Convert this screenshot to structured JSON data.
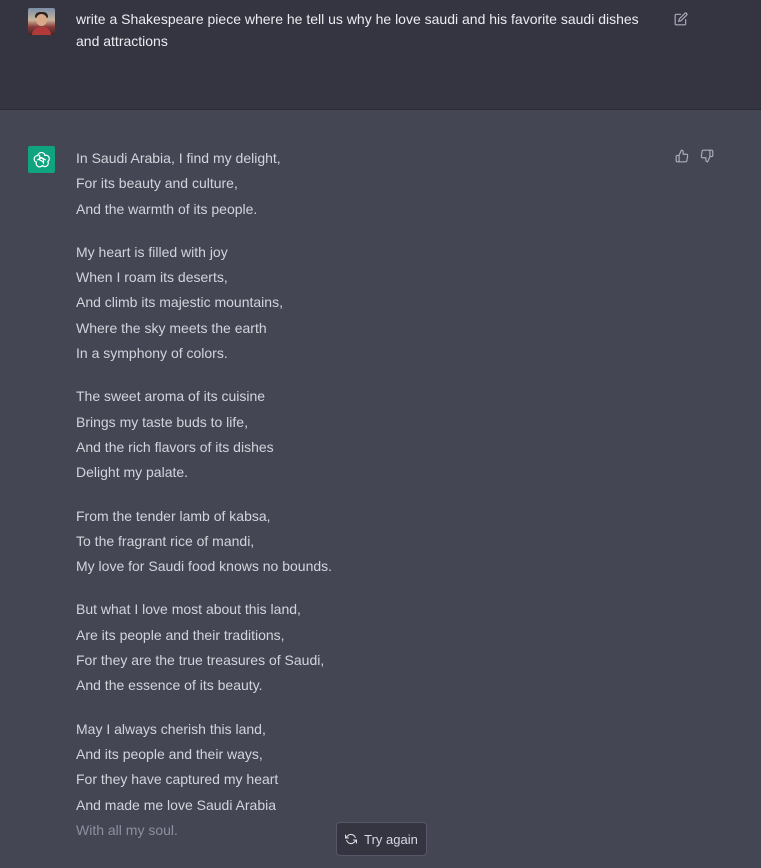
{
  "user_message": {
    "text": "write a Shakespeare piece where he tell us why he love saudi and his favorite saudi dishes and attractions",
    "avatar_icon": "user-avatar",
    "edit_icon": "edit-icon"
  },
  "assistant_message": {
    "avatar_icon": "openai-logo-icon",
    "avatar_color": "#10a37f",
    "feedback": {
      "thumbs_up_icon": "thumbs-up-icon",
      "thumbs_down_icon": "thumbs-down-icon"
    },
    "stanzas": [
      [
        "In Saudi Arabia, I find my delight,",
        "For its beauty and culture,",
        "And the warmth of its people."
      ],
      [
        "My heart is filled with joy",
        "When I roam its deserts,",
        "And climb its majestic mountains,",
        "Where the sky meets the earth",
        "In a symphony of colors."
      ],
      [
        "The sweet aroma of its cuisine",
        "Brings my taste buds to life,",
        "And the rich flavors of its dishes",
        "Delight my palate."
      ],
      [
        "From the tender lamb of kabsa,",
        "To the fragrant rice of mandi,",
        "My love for Saudi food knows no bounds."
      ],
      [
        "But what I love most about this land,",
        "Are its people and their traditions,",
        "For they are the true treasures of Saudi,",
        "And the essence of its beauty."
      ],
      [
        "May I always cherish this land,",
        "And its people and their ways,",
        "For they have captured my heart",
        "And made me love Saudi Arabia",
        "With all my soul."
      ]
    ]
  },
  "try_again": {
    "label": "Try again",
    "icon": "refresh-icon"
  },
  "colors": {
    "user_bg": "#343541",
    "assistant_bg": "#444654",
    "text": "#d1d5db"
  }
}
